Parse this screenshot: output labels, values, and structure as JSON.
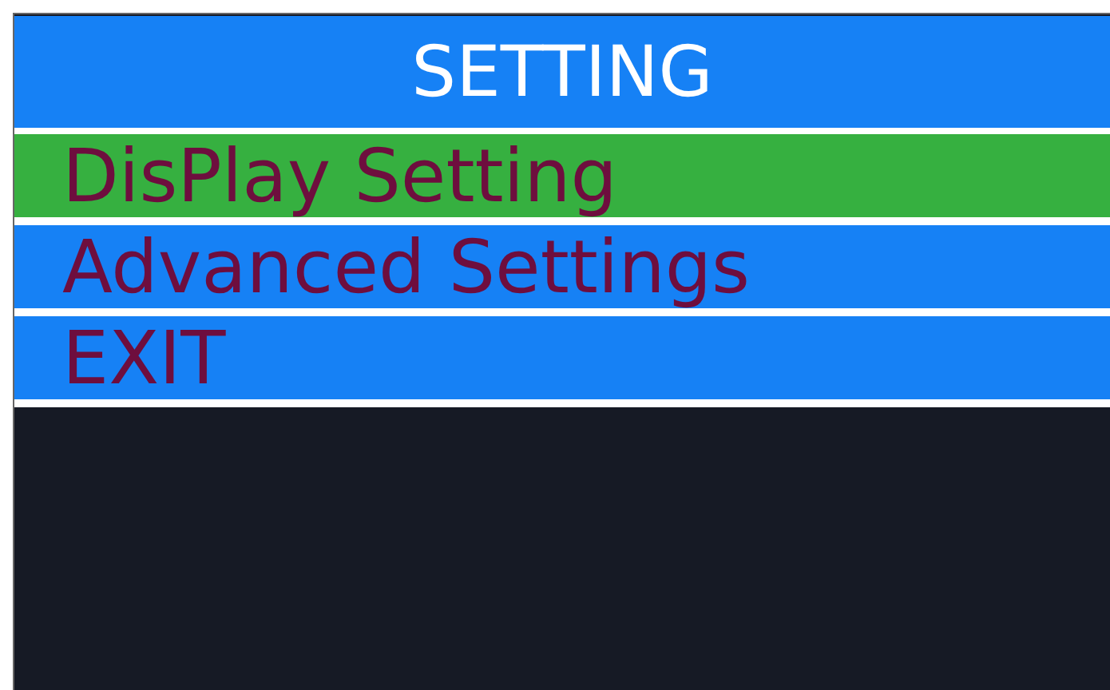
{
  "title": "SETTING",
  "menu": [
    {
      "label": "DisPlay Setting",
      "selected": true
    },
    {
      "label": "Advanced Settings",
      "selected": false
    },
    {
      "label": "EXIT",
      "selected": false
    }
  ]
}
